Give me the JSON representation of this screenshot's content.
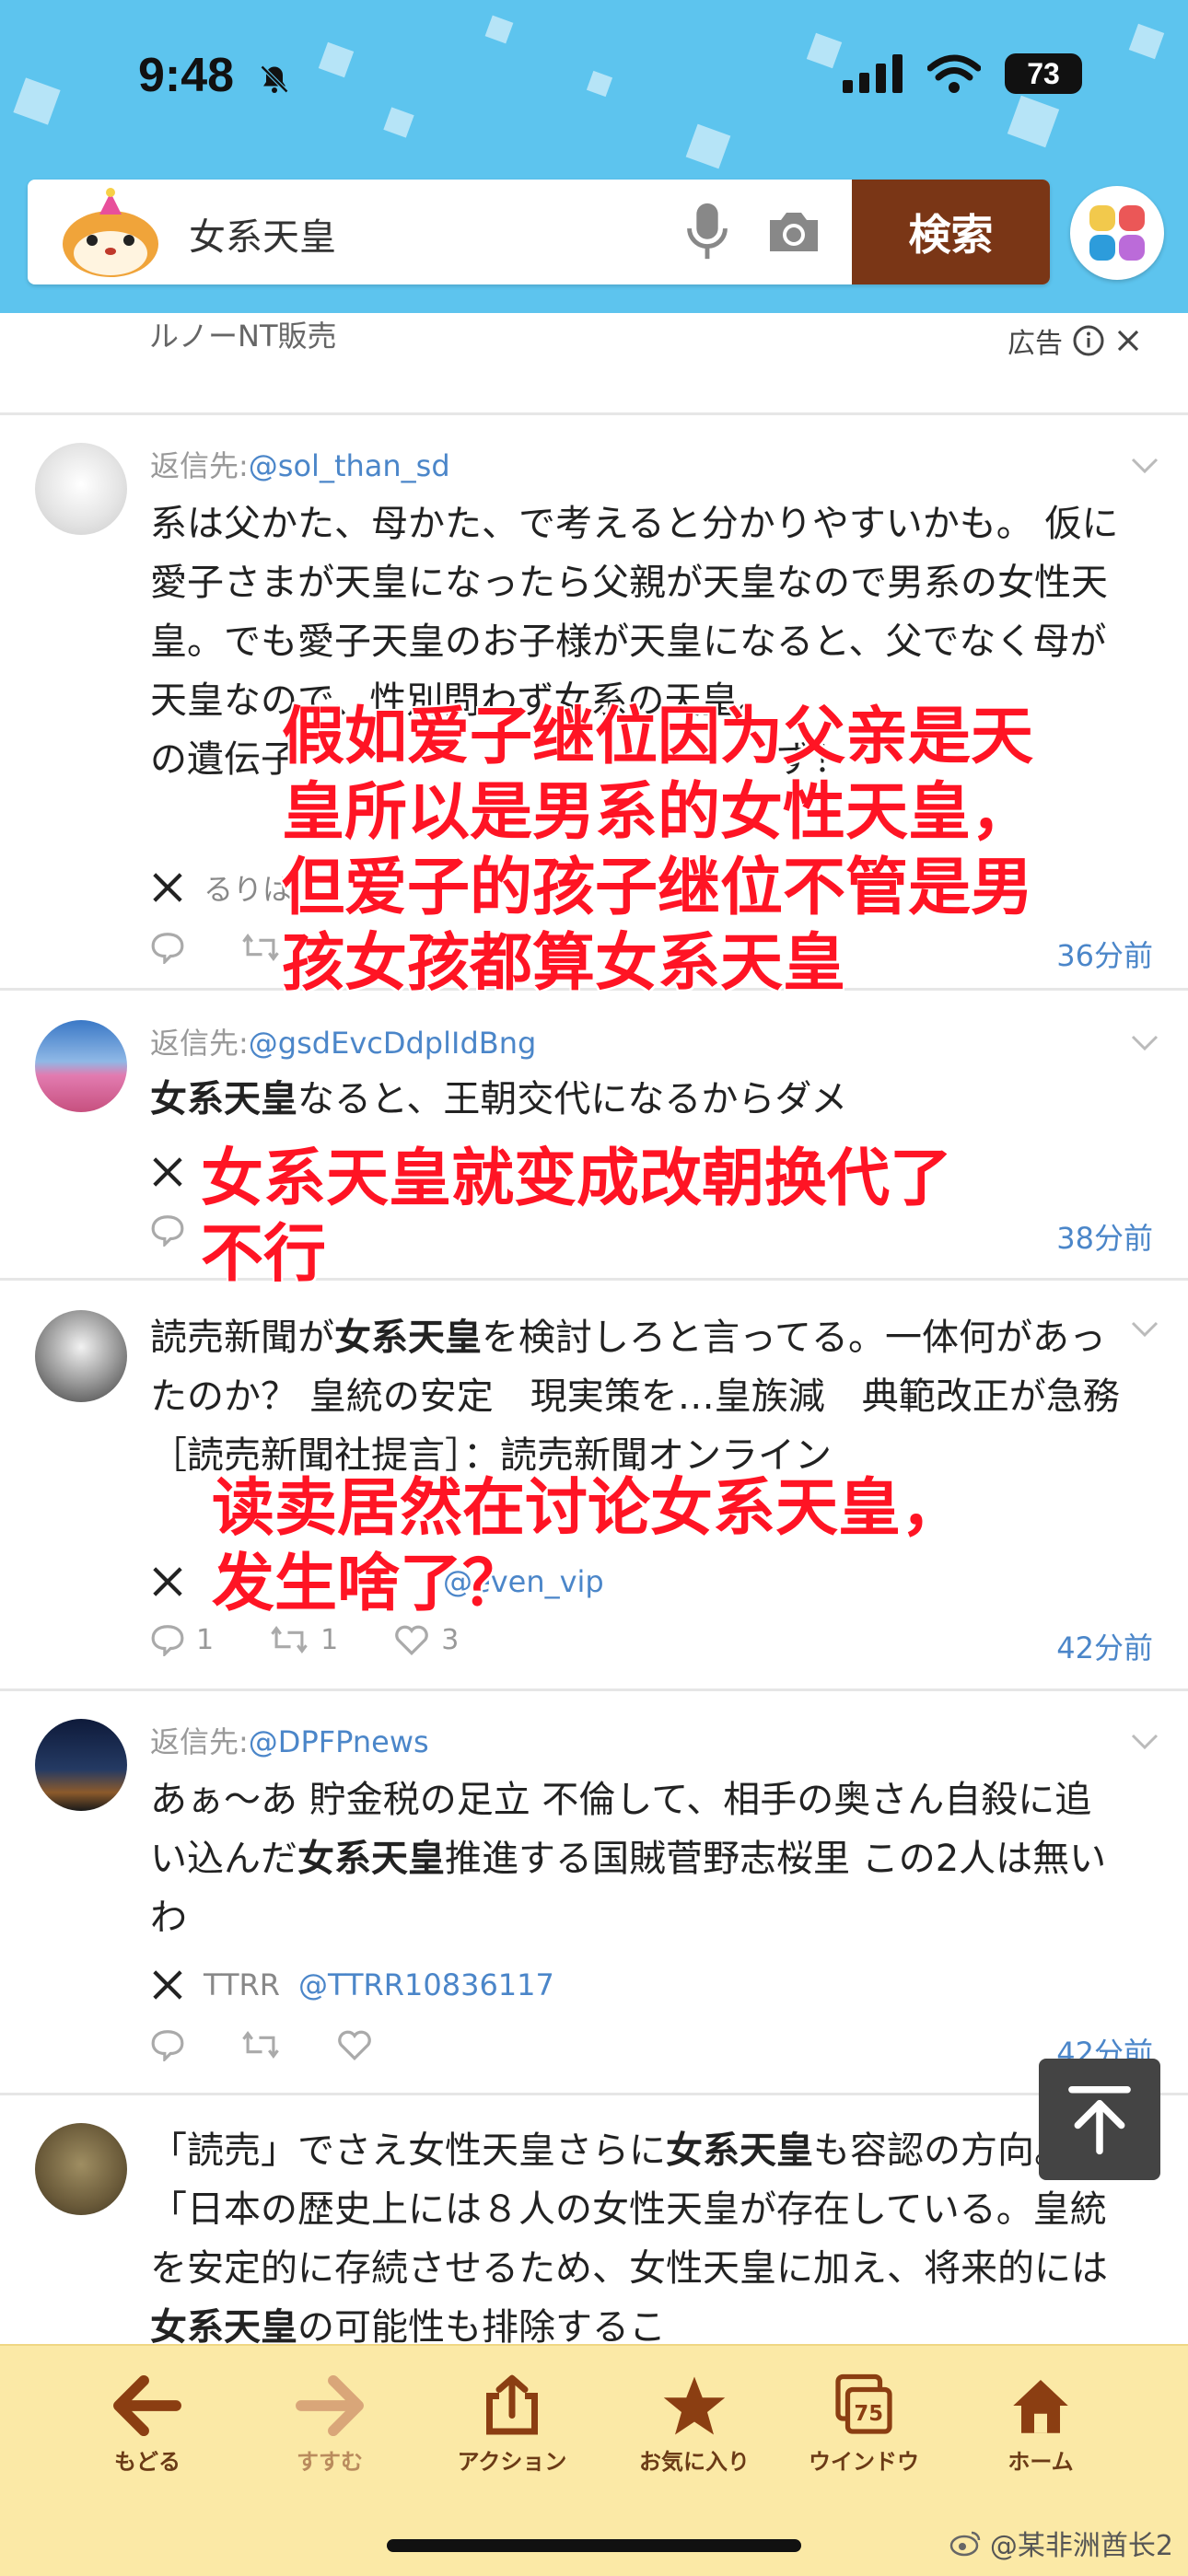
{
  "status": {
    "time": "9:48",
    "battery": "73"
  },
  "search": {
    "query": "女系天皇",
    "button": "検索"
  },
  "ad": {
    "text": "ルノーNT販売",
    "label": "広告"
  },
  "posts": [
    {
      "reply_prefix": "返信先:",
      "reply_handle": "@sol_than_sd",
      "text": "系は父かた、母かた、で考えると分かりやすいかも。 仮に愛子さまが天皇になったら父親が天皇なので男系の女性天皇。でも愛子天皇のお子様が天皇になると、父でなく母が天皇なので、性別問わず女系の天皇。",
      "text_tail": "の遺伝子",
      "text_end": "ず！",
      "author": "るりは",
      "time": "36分前"
    },
    {
      "reply_prefix": "返信先:",
      "reply_handle": "@gsdEvcDdplIdBng",
      "bold": "女系天皇",
      "text": "なると、王朝交代になるからダメ",
      "time": "38分前"
    },
    {
      "text_a": "読売新聞が",
      "bold": "女系天皇",
      "text_b": "を検討しろと言ってる。一体何があったのか？ 皇統の安定　現実策を…皇族減　典範改正が急務［読売新聞社提言］：読売新聞オンライン",
      "author_handle": "@even_vip",
      "reply_count": "1",
      "retweet_count": "1",
      "like_count": "3",
      "time": "42分前"
    },
    {
      "reply_prefix": "返信先:",
      "reply_handle": "@DPFPnews",
      "text_a": "あぁ〜あ 貯金税の足立 不倫して、相手の奥さん自殺に追い込んだ",
      "bold": "女系天皇",
      "text_b": "推進する国賊菅野志桜里 この2人は無いわ",
      "author": "TTRR",
      "author_handle": "@TTRR10836117",
      "time": "42分前"
    },
    {
      "text_a": "「読売」でさえ女性天皇さらに",
      "bold": "女系天皇",
      "text_b": "も容認の方向。＜「日本の歴史上には８人の女性天皇が存在している。皇統を安定的に存続させるため、女性天皇に加え、将来的には",
      "bold2": "女系天皇",
      "text_c": "の可能性も排除するこ"
    }
  ],
  "overlays": {
    "o1": "假如爱子继位因为父亲是天\n皇所以是男系的女性天皇，\n但爱子的孩子继位不管是男\n孩女孩都算女系天皇",
    "o2": "女系天皇就变成改朝换代了\n不行",
    "o3": "读卖居然在讨论女系天皇，\n发生啥了？"
  },
  "toolbar": {
    "back": "もどる",
    "forward": "すすむ",
    "action": "アクション",
    "favorites": "お気に入り",
    "windows": "ウインドウ",
    "windows_count": "75",
    "home": "ホーム"
  },
  "watermark": "@某非洲酋长2"
}
